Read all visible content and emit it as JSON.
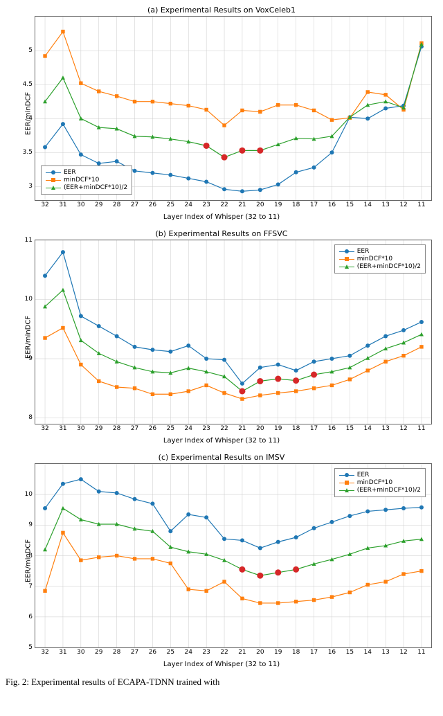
{
  "caption": "Fig. 2: Experimental results of ECAPA-TDNN trained with",
  "chart_data": [
    {
      "id": "voxceleb1",
      "title": "(a) Experimental Results on VoxCeleb1",
      "type": "line",
      "xlabel": "Layer Index of Whisper (32 to 11)",
      "ylabel": "EER/minDCF",
      "categories": [
        "32",
        "31",
        "30",
        "29",
        "28",
        "27",
        "26",
        "25",
        "24",
        "23",
        "22",
        "21",
        "20",
        "19",
        "18",
        "17",
        "16",
        "15",
        "14",
        "13",
        "12",
        "11"
      ],
      "ylim": [
        2.8,
        5.5
      ],
      "yticks": [
        3.0,
        3.5,
        4.0,
        4.5,
        5.0
      ],
      "legend_pos": "bottom-left",
      "series": [
        {
          "name": "EER",
          "color": "eer",
          "marker": "circle",
          "values": [
            3.58,
            3.92,
            3.47,
            3.34,
            3.37,
            3.23,
            3.2,
            3.17,
            3.12,
            3.07,
            2.96,
            2.93,
            2.95,
            3.03,
            3.21,
            3.28,
            3.5,
            4.02,
            4.0,
            4.15,
            4.19,
            5.06
          ]
        },
        {
          "name": "minDCF*10",
          "color": "dcf",
          "marker": "square",
          "values": [
            4.92,
            5.28,
            4.52,
            4.4,
            4.33,
            4.25,
            4.25,
            4.22,
            4.19,
            4.13,
            3.9,
            4.12,
            4.1,
            4.2,
            4.2,
            4.12,
            3.98,
            4.01,
            4.39,
            4.35,
            4.13,
            5.11
          ]
        },
        {
          "name": "(EER+minDCF*10)/2",
          "color": "avg",
          "marker": "triangle",
          "values": [
            4.25,
            4.6,
            4.0,
            3.87,
            3.85,
            3.74,
            3.73,
            3.7,
            3.66,
            3.6,
            3.43,
            3.53,
            3.53,
            3.62,
            3.71,
            3.7,
            3.74,
            4.02,
            4.2,
            4.25,
            4.16,
            5.09
          ],
          "highlight_indices": [
            9,
            10,
            11,
            12
          ]
        }
      ]
    },
    {
      "id": "ffsvc",
      "title": "(b) Experimental Results on FFSVC",
      "type": "line",
      "xlabel": "Layer Index of Whisper (32 to 11)",
      "ylabel": "EER/minDCF",
      "categories": [
        "32",
        "31",
        "30",
        "29",
        "28",
        "27",
        "26",
        "25",
        "24",
        "23",
        "22",
        "21",
        "20",
        "19",
        "18",
        "17",
        "16",
        "15",
        "14",
        "13",
        "12",
        "11"
      ],
      "ylim": [
        7.9,
        11.0
      ],
      "yticks": [
        8,
        9,
        10,
        11
      ],
      "legend_pos": "top-right",
      "series": [
        {
          "name": "EER",
          "color": "eer",
          "marker": "circle",
          "values": [
            10.4,
            10.8,
            9.72,
            9.55,
            9.38,
            9.2,
            9.15,
            9.12,
            9.22,
            9.0,
            8.98,
            8.58,
            8.85,
            8.9,
            8.8,
            8.95,
            9.0,
            9.05,
            9.22,
            9.38,
            9.48,
            9.62
          ]
        },
        {
          "name": "minDCF*10",
          "color": "dcf",
          "marker": "square",
          "values": [
            9.35,
            9.52,
            8.9,
            8.62,
            8.52,
            8.5,
            8.4,
            8.4,
            8.45,
            8.55,
            8.42,
            8.32,
            8.38,
            8.42,
            8.45,
            8.5,
            8.55,
            8.65,
            8.8,
            8.95,
            9.05,
            9.2
          ]
        },
        {
          "name": "(EER+minDCF*10)/2",
          "color": "avg",
          "marker": "triangle",
          "values": [
            9.88,
            10.16,
            9.31,
            9.09,
            8.95,
            8.85,
            8.78,
            8.76,
            8.84,
            8.78,
            8.7,
            8.45,
            8.62,
            8.66,
            8.63,
            8.73,
            8.78,
            8.85,
            9.01,
            9.17,
            9.27,
            9.41
          ],
          "highlight_indices": [
            11,
            12,
            13,
            14,
            15
          ]
        }
      ]
    },
    {
      "id": "imsv",
      "title": "(c) Experimental Results on IMSV",
      "type": "line",
      "xlabel": "Layer Index of Whisper (32 to 11)",
      "ylabel": "EER/minDCF",
      "categories": [
        "32",
        "31",
        "30",
        "29",
        "28",
        "27",
        "26",
        "25",
        "24",
        "23",
        "22",
        "21",
        "20",
        "19",
        "18",
        "17",
        "16",
        "15",
        "14",
        "13",
        "12",
        "11"
      ],
      "ylim": [
        5.0,
        11.0
      ],
      "yticks": [
        5,
        6,
        7,
        8,
        9,
        10
      ],
      "legend_pos": "top-right",
      "series": [
        {
          "name": "EER",
          "color": "eer",
          "marker": "circle",
          "values": [
            9.55,
            10.35,
            10.5,
            10.1,
            10.05,
            9.85,
            9.7,
            8.8,
            9.35,
            9.25,
            8.55,
            8.5,
            8.25,
            8.45,
            8.6,
            8.9,
            9.1,
            9.3,
            9.45,
            9.5,
            9.55,
            9.58
          ]
        },
        {
          "name": "minDCF*10",
          "color": "dcf",
          "marker": "square",
          "values": [
            6.85,
            8.75,
            7.85,
            7.95,
            8.0,
            7.9,
            7.9,
            7.75,
            6.9,
            6.85,
            7.15,
            6.6,
            6.45,
            6.45,
            6.5,
            6.55,
            6.65,
            6.8,
            7.05,
            7.15,
            7.4,
            7.5
          ]
        },
        {
          "name": "(EER+minDCF*10)/2",
          "color": "avg",
          "marker": "triangle",
          "values": [
            8.2,
            9.55,
            9.18,
            9.03,
            9.03,
            8.88,
            8.8,
            8.28,
            8.13,
            8.05,
            7.85,
            7.55,
            7.35,
            7.45,
            7.55,
            7.73,
            7.88,
            8.05,
            8.25,
            8.33,
            8.48,
            8.54
          ],
          "highlight_indices": [
            11,
            12,
            13,
            14
          ]
        }
      ]
    }
  ]
}
